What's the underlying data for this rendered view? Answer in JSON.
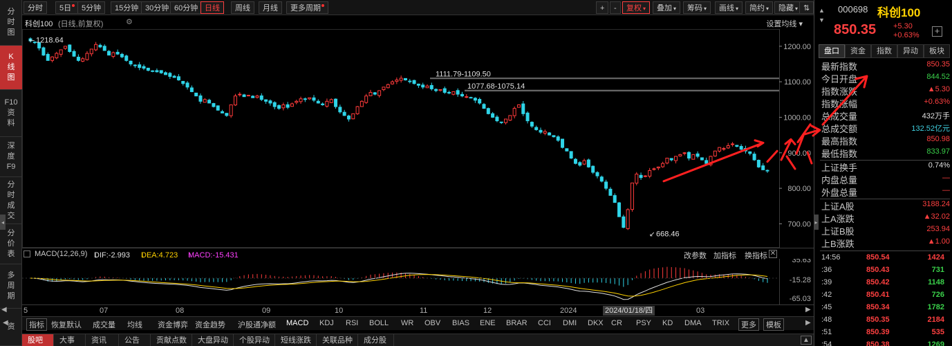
{
  "leftnav": [
    {
      "label": "分时图",
      "chars": [
        "分",
        "时",
        "图"
      ],
      "active": false
    },
    {
      "label": "K线图",
      "chars": [
        "K",
        "线",
        "图"
      ],
      "active": true
    },
    {
      "label": "F10资料",
      "chars": [
        "F10",
        "资",
        "料"
      ],
      "active": false
    },
    {
      "label": "深度F9",
      "chars": [
        "深",
        "度",
        "F9"
      ],
      "active": false
    },
    {
      "label": "分时成交",
      "chars": [
        "分",
        "时",
        "成",
        "交"
      ],
      "active": false
    },
    {
      "label": "分价表",
      "chars": [
        "分",
        "价",
        "表"
      ],
      "active": false
    },
    {
      "label": "多周期",
      "chars": [
        "多",
        "周",
        "期"
      ],
      "active": false
    },
    {
      "label": "资",
      "chars": [
        "资"
      ],
      "active": false
    }
  ],
  "toolbar": {
    "periods": [
      "分时",
      "5日",
      "5分钟",
      "15分钟",
      "30分钟",
      "60分钟",
      "日线",
      "周线",
      "月线",
      "更多周期"
    ],
    "active_period": "日线",
    "right_buttons": [
      "+",
      "-",
      "复权",
      "叠加",
      "筹码",
      "画线",
      "简约",
      "隐藏"
    ]
  },
  "chart_header": {
    "name": "科创100",
    "subtitle": "(日线,前复权)",
    "ma_setting": "设置均线"
  },
  "chart_data": [
    {
      "type": "candlestick",
      "title": "科创100 (日线,前复权)",
      "y_ticks": [
        "1200.00",
        "1100.00",
        "1000.00",
        "900.00",
        "800.00",
        "700.00"
      ],
      "y_tick_values": [
        1200,
        1100,
        1000,
        900,
        800,
        700
      ],
      "ylim": [
        656,
        1225
      ],
      "x_labels": [
        "5",
        "07",
        "08",
        "09",
        "10",
        "11",
        "12",
        "2024",
        "2024/01/18/四",
        "03"
      ],
      "annotations": [
        {
          "text": "1218.64",
          "kind": "period-high"
        },
        {
          "text": "1111.79-1109.50",
          "kind": "range"
        },
        {
          "text": "1077.68-1075.14",
          "kind": "range"
        },
        {
          "text": "668.46",
          "kind": "period-low"
        }
      ],
      "close_path": [
        1215,
        1210,
        1195,
        1175,
        1160,
        1170,
        1180,
        1190,
        1200,
        1185,
        1172,
        1160,
        1165,
        1180,
        1192,
        1205,
        1198,
        1188,
        1175,
        1182,
        1178,
        1170,
        1160,
        1150,
        1145,
        1140,
        1138,
        1132,
        1130,
        1128,
        1125,
        1120,
        1115,
        1112,
        1105,
        1095,
        1085,
        1072,
        1060,
        1045,
        1050,
        1040,
        1030,
        1020,
        1012,
        1005,
        1035,
        1060,
        1065,
        1058,
        1062,
        1055,
        1060,
        1050,
        1045,
        1040,
        1030,
        1025,
        1035,
        1028,
        1038,
        1045,
        1052,
        1050,
        1055,
        1048,
        1040,
        1035,
        1045,
        1050,
        1030,
        1015,
        1005,
        995,
        1010,
        1030,
        1045,
        1060,
        1070,
        1065,
        1075,
        1085,
        1092,
        1100,
        1105,
        1110,
        1105,
        1100,
        1095,
        1090,
        1085,
        1088,
        1080,
        1075,
        1078,
        1070,
        1068,
        1072,
        1065,
        1060,
        1058,
        1055,
        1048,
        1040,
        1025,
        1010,
        1000,
        990,
        985,
        995,
        1005,
        1025,
        1035,
        1010,
        990,
        975,
        965,
        958,
        960,
        950,
        945,
        935,
        915,
        905,
        885,
        870,
        865,
        878,
        860,
        845,
        835,
        820,
        800,
        780,
        760,
        720,
        690,
        740,
        815,
        840,
        830,
        835,
        850,
        855,
        860,
        870,
        885,
        880,
        890,
        895,
        900,
        885,
        895,
        890,
        880,
        870,
        890,
        905,
        915,
        912,
        920,
        925,
        918,
        910,
        905,
        898,
        880,
        860,
        852,
        850
      ],
      "series": [
        {
          "name": "MACD",
          "values": [
            -2.993,
            4.723,
            -15.431
          ]
        }
      ]
    },
    {
      "type": "bar",
      "title": "MACD(12,26,9)",
      "y_ticks": [
        "35.63",
        "-15.28",
        "-65.03"
      ],
      "y_tick_values": [
        35.63,
        -15.28,
        -65.03
      ],
      "series": [
        {
          "name": "DIF",
          "value": -2.993
        },
        {
          "name": "DEA",
          "value": 4.723
        },
        {
          "name": "MACD",
          "value": -15.431
        }
      ]
    }
  ],
  "macd_header": {
    "title": "MACD(12,26,9)",
    "dif_label": "DIF:-2.993",
    "dif_arrow": "↓",
    "dea_label": "DEA:4.723",
    "dea_arrow": "↓",
    "macd_label": "MACD:-15.431",
    "macd_arrow": "↑",
    "buttons": [
      "改参数",
      "加指标",
      "换指标"
    ]
  },
  "indicator_tabs": [
    "指标",
    "恢复默认",
    "成交量",
    "均线",
    "资金博弈",
    "资金趋势",
    "沪股通净额",
    "MACD",
    "KDJ",
    "RSI",
    "BOLL",
    "WR",
    "OBV",
    "BIAS",
    "ENE",
    "BRAR",
    "CCI",
    "DMI",
    "DKX",
    "CR",
    "PSY",
    "KD",
    "DMA",
    "TRIX",
    "更多",
    "模板"
  ],
  "bottom_tabs": [
    "股吧",
    "大事",
    "资讯",
    "公告",
    "贡献点数",
    "大盘异动",
    "个股异动",
    "短线涨跌",
    "关联品种",
    "成分股"
  ],
  "right_panel": {
    "code": "000698",
    "name": "科创100",
    "price": "850.35",
    "change": "+5.30",
    "change_pct": "+0.63%",
    "tabs": [
      "盘口",
      "资金",
      "指数",
      "异动",
      "板块"
    ],
    "stats": [
      {
        "k": "最新指数",
        "v": "850.35",
        "color": "red"
      },
      {
        "k": "今日开盘",
        "v": "844.52",
        "color": "green"
      },
      {
        "k": "指数涨跌",
        "v": "▲5.30",
        "color": "red"
      },
      {
        "k": "指数涨幅",
        "v": "+0.63%",
        "color": "red"
      },
      {
        "k": "总成交量",
        "v": "432万手",
        "color": "white"
      },
      {
        "k": "总成交额",
        "v": "132.52亿元",
        "color": "cyan"
      },
      {
        "k": "最高指数",
        "v": "850.98",
        "color": "red"
      },
      {
        "k": "最低指数",
        "v": "833.97",
        "color": "green"
      },
      {
        "k": "上证换手",
        "v": "0.74%",
        "color": "white"
      },
      {
        "k": "内盘总量",
        "v": "—",
        "color": "red"
      },
      {
        "k": "外盘总量",
        "v": "—",
        "color": "red"
      }
    ],
    "stats2": [
      {
        "k": "上证A股",
        "v": "3188.24",
        "color": "red"
      },
      {
        "k": "上A涨跌",
        "v": "▲32.02",
        "color": "red"
      },
      {
        "k": "上证B股",
        "v": "253.94",
        "color": "red"
      },
      {
        "k": "上B涨跌",
        "v": "▲1.00",
        "color": "red"
      }
    ],
    "ticks": [
      {
        "t": "14:56",
        "p": "850.54",
        "q": "1424",
        "color": "red"
      },
      {
        "t": ":36",
        "p": "850.43",
        "q": "731",
        "color": "green"
      },
      {
        "t": ":39",
        "p": "850.42",
        "q": "1148",
        "color": "green"
      },
      {
        "t": ":42",
        "p": "850.41",
        "q": "726",
        "color": "green"
      },
      {
        "t": ":45",
        "p": "850.34",
        "q": "1782",
        "color": "green"
      },
      {
        "t": ":48",
        "p": "850.35",
        "q": "2184",
        "color": "red"
      },
      {
        "t": ":51",
        "p": "850.39",
        "q": "535",
        "color": "red"
      },
      {
        "t": ":54",
        "p": "850.38",
        "q": "1269",
        "color": "green"
      }
    ]
  }
}
